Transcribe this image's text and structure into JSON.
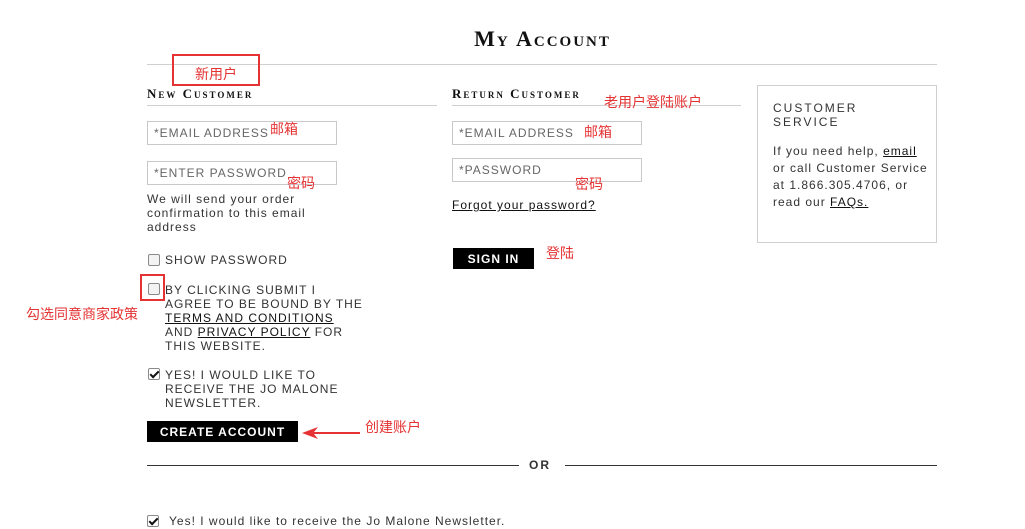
{
  "page": {
    "title": "My Account"
  },
  "new_customer": {
    "title": "New Customer",
    "email_placeholder": "*EMAIL ADDRESS",
    "password_placeholder": "*ENTER PASSWORD",
    "note": "We will send your order confirmation to this email address",
    "show_password_label": "SHOW PASSWORD",
    "terms_pre": "BY CLICKING SUBMIT I AGREE TO BE BOUND BY THE ",
    "terms_link": "TERMS AND CONDITIONS",
    "terms_mid": " AND ",
    "privacy_link": "PRIVACY POLICY",
    "terms_post": " FOR THIS WEBSITE.",
    "newsletter_label": "YES! I WOULD LIKE TO RECEIVE THE JO MALONE NEWSLETTER.",
    "create_button": "CREATE ACCOUNT"
  },
  "return_customer": {
    "title": "Return Customer",
    "email_placeholder": "*EMAIL ADDRESS",
    "password_placeholder": "*PASSWORD",
    "forgot_link": "Forgot your password?",
    "signin_button": "SIGN IN"
  },
  "customer_service": {
    "title": "CUSTOMER SERVICE",
    "text1": "If you need help, ",
    "email_link": "email",
    "text2": " or call Customer Service at 1.866.305.4706, or read our ",
    "faq_link": "FAQs."
  },
  "divider": {
    "or_text": "OR"
  },
  "bottom": {
    "newsletter_label": "Yes! I would like to receive the Jo Malone Newsletter."
  },
  "annotations": {
    "new_user": "新用户",
    "email_1": "邮箱",
    "password_1": "密码",
    "old_user": "老用户登陆账户",
    "email_2": "邮箱",
    "password_2": "密码",
    "signin": "登陆",
    "agree_policy": "勾选同意商家政策",
    "create_account": "创建账户"
  },
  "colors": {
    "annotation": "#e53333",
    "button": "#000000"
  }
}
